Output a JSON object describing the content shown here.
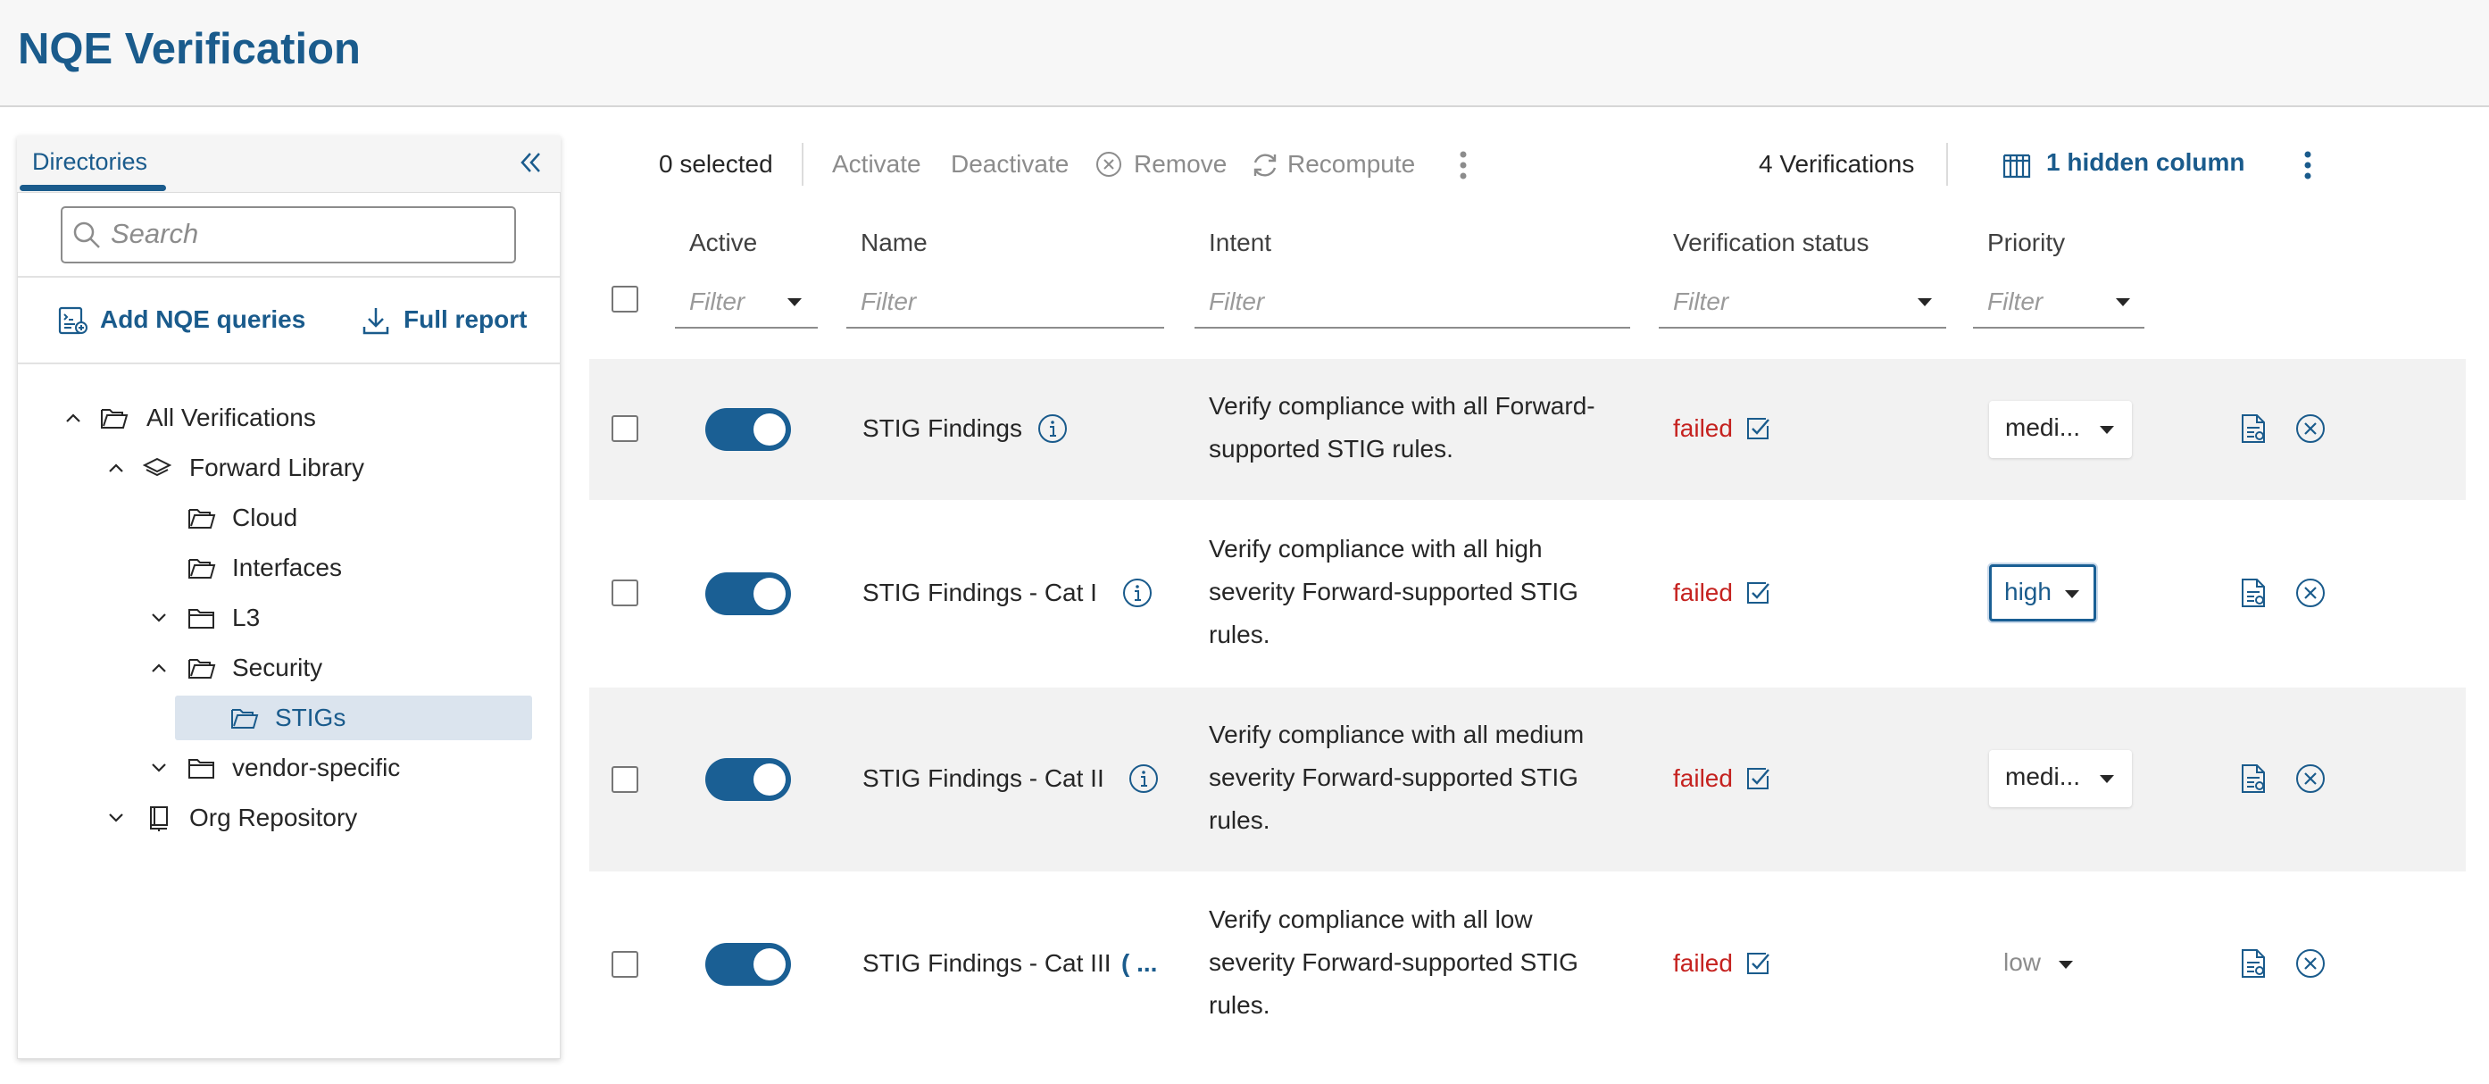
{
  "header": {
    "title": "NQE Verification"
  },
  "sidebar": {
    "tab_label": "Directories",
    "search_placeholder": "Search",
    "add_queries_label": "Add NQE queries",
    "full_report_label": "Full report",
    "tree": [
      {
        "label": "All Verifications",
        "expanded": true,
        "icon": "folder-open-icon"
      },
      {
        "label": "Forward Library",
        "expanded": true,
        "icon": "layers-icon"
      },
      {
        "label": "Cloud",
        "icon": "folder-open-icon"
      },
      {
        "label": "Interfaces",
        "icon": "folder-open-icon"
      },
      {
        "label": "L3",
        "expanded": false,
        "icon": "folder-icon"
      },
      {
        "label": "Security",
        "expanded": true,
        "icon": "folder-open-icon"
      },
      {
        "label": "STIGs",
        "selected": true,
        "icon": "folder-open-icon"
      },
      {
        "label": "vendor-specific",
        "expanded": false,
        "icon": "folder-icon"
      },
      {
        "label": "Org Repository",
        "expanded": false,
        "icon": "book-icon"
      }
    ]
  },
  "toolbar": {
    "selected_count": "0 selected",
    "activate": "Activate",
    "deactivate": "Deactivate",
    "remove": "Remove",
    "recompute": "Recompute",
    "verifications_count": "4 Verifications",
    "hidden_columns": "1 hidden column"
  },
  "table": {
    "columns": {
      "active": "Active",
      "name": "Name",
      "intent": "Intent",
      "status": "Verification status",
      "priority": "Priority"
    },
    "filter_placeholder": "Filter",
    "rows": [
      {
        "active": true,
        "name": "STIG Findings",
        "intent_lines": [
          "Verify compliance with all Forward-",
          "supported STIG rules."
        ],
        "status": "failed",
        "priority": "medi..."
      },
      {
        "active": true,
        "name": "STIG Findings - Cat I",
        "intent_lines": [
          "Verify compliance with all high",
          "severity Forward-supported STIG",
          "rules."
        ],
        "status": "failed",
        "priority": "high"
      },
      {
        "active": true,
        "name": "STIG Findings - Cat II",
        "intent_lines": [
          "Verify compliance with all medium",
          "severity Forward-supported STIG",
          "rules."
        ],
        "status": "failed",
        "priority": "medi..."
      },
      {
        "active": true,
        "name": "STIG Findings - Cat III",
        "name_suffix": "( ...",
        "intent_lines": [
          "Verify compliance with all low",
          "severity Forward-supported STIG",
          "rules."
        ],
        "status": "failed",
        "priority": "low"
      }
    ]
  },
  "colors": {
    "accent": "#1a5b8c",
    "failed": "#c5221f",
    "toggle_on": "#1a5f94",
    "selected_tree_bg": "#dbe4ee"
  }
}
